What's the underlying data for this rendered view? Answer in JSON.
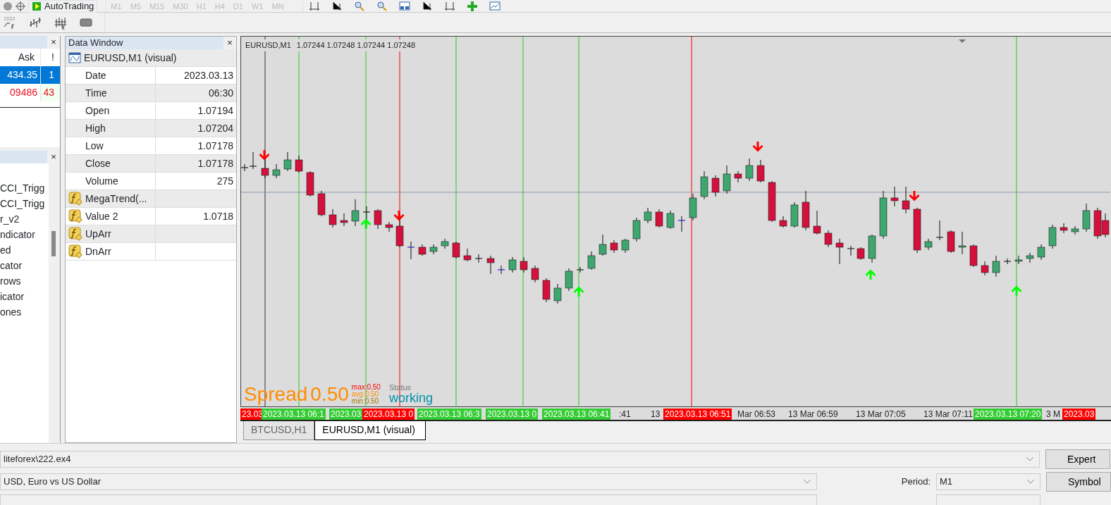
{
  "toolbar": {
    "autotrading": "AutoTrading",
    "timeframes": [
      {
        "label": "M1",
        "disabled": true
      },
      {
        "label": "M5",
        "disabled": true
      },
      {
        "label": "M15",
        "disabled": true
      },
      {
        "label": "M30",
        "disabled": true
      },
      {
        "label": "H1",
        "disabled": true
      },
      {
        "label": "H4",
        "disabled": true
      },
      {
        "label": "D1",
        "disabled": true
      },
      {
        "label": "W1",
        "disabled": true
      },
      {
        "label": "MN",
        "disabled": true
      }
    ]
  },
  "market_watch": {
    "close": "×",
    "columns": [
      "Ask",
      "!"
    ],
    "rows": [
      {
        "ask": "434.35",
        "count": "1",
        "selected": true,
        "down": false
      },
      {
        "ask": "09486",
        "count": "43",
        "selected": false,
        "down": true
      }
    ]
  },
  "navigator": {
    "close": "×",
    "items": [
      "CCI_Trigg",
      "CCI_Trigg",
      "r_v2",
      "ndicator",
      "ed",
      "cator",
      "rows",
      "icator",
      "ones"
    ]
  },
  "data_window": {
    "title": "Data Window",
    "close": "×",
    "header": "EURUSD,M1 (visual)",
    "rows": [
      {
        "kind": "field",
        "label": "Date",
        "value": "2023.03.13"
      },
      {
        "kind": "field",
        "label": "Time",
        "value": "06:30"
      },
      {
        "kind": "field",
        "label": "Open",
        "value": "1.07194"
      },
      {
        "kind": "field",
        "label": "High",
        "value": "1.07204"
      },
      {
        "kind": "field",
        "label": "Low",
        "value": "1.07178"
      },
      {
        "kind": "field",
        "label": "Close",
        "value": "1.07178"
      },
      {
        "kind": "field",
        "label": "Volume",
        "value": "275"
      },
      {
        "kind": "indicator",
        "label": "MegaTrend(..."
      },
      {
        "kind": "indicator",
        "label": "Value 2",
        "value": "1.0718"
      },
      {
        "kind": "indicator",
        "label": "UpArr"
      },
      {
        "kind": "indicator",
        "label": "DnArr"
      }
    ]
  },
  "chart": {
    "symbol": "EURUSD,M1",
    "quote": "1.07244 1.07248 1.07244 1.07248",
    "spread": {
      "label": "Spread",
      "value": "0.50",
      "max": "max:0.50",
      "avg": "avg:0.50",
      "min": "min:0.50",
      "status_label": "Status",
      "status": "working"
    },
    "time_labels": [
      {
        "text": "23.03",
        "color": "#ff0000"
      },
      {
        "text": "2023.03.13 06:1",
        "color": "#33cc33"
      },
      {
        "text": "2023.03",
        "color": "#33cc33"
      },
      {
        "text": "2023.03.13 0",
        "color": "#ff0000"
      },
      {
        "text": "2023.03.13 06:3",
        "color": "#33cc33"
      },
      {
        "text": "2023.03.13 0",
        "color": "#33cc33"
      },
      {
        "text": "2023.03.13 06:41",
        "color": "#33cc33"
      },
      {
        "text": ":41"
      },
      {
        "text": "13"
      },
      {
        "text": "2023.03.13 06:51",
        "color": "#ff0000"
      },
      {
        "text": "Mar 06:53"
      },
      {
        "text": "13 Mar 06:59"
      },
      {
        "text": "13 Mar 07:05"
      },
      {
        "text": "13 Mar 07:11"
      },
      {
        "text": "2023.03.13 07:20",
        "color": "#33cc33"
      },
      {
        "text": "3 M"
      },
      {
        "text": "2023.03",
        "color": "#ff0000"
      }
    ],
    "tabs": [
      {
        "label": "BTCUSD,H1",
        "selected": false
      },
      {
        "label": "EURUSD,M1 (visual)",
        "selected": true
      }
    ]
  },
  "tester": {
    "expert": "liteforex\\222.ex4",
    "expert_button": "Expert",
    "symbol": "USD, Euro vs US Dollar",
    "period_label": "Period:",
    "period": "M1",
    "symbol_button": "Symbol"
  }
}
